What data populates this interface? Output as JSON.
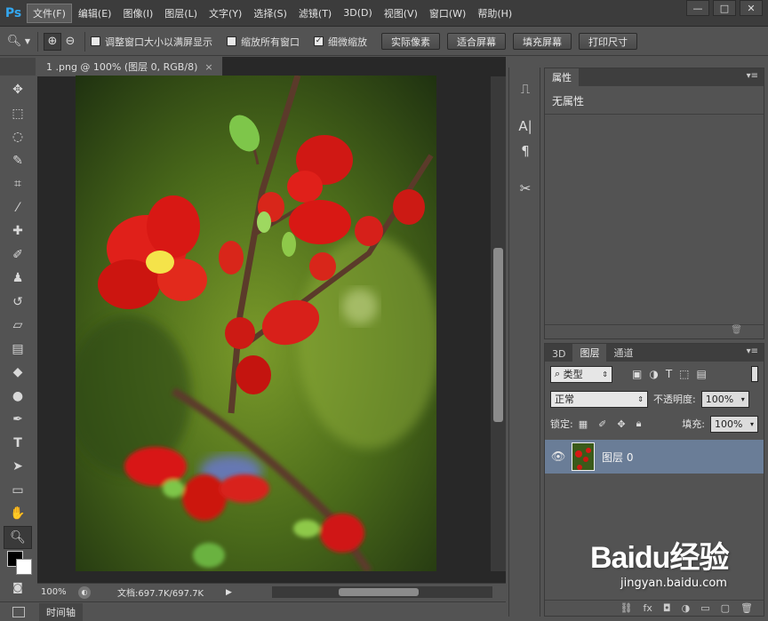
{
  "app": {
    "logo": "Ps"
  },
  "menu": [
    "文件(F)",
    "编辑(E)",
    "图像(I)",
    "图层(L)",
    "文字(Y)",
    "选择(S)",
    "滤镜(T)",
    "3D(D)",
    "视图(V)",
    "窗口(W)",
    "帮助(H)"
  ],
  "window_controls": [
    "—",
    "□",
    "✕"
  ],
  "options": {
    "check_resize": "调整窗口大小以满屏显示",
    "check_zoom_all": "缩放所有窗口",
    "check_scrubby": "细微缩放",
    "scrubby_checked": true,
    "btn_actual": "实际像素",
    "btn_fit": "适合屏幕",
    "btn_fill": "填充屏幕",
    "btn_print": "打印尺寸"
  },
  "document": {
    "tab_title": "1 .png @ 100% (图层 0, RGB/8)",
    "close": "×"
  },
  "status": {
    "zoom": "100%",
    "doc_info": "文档:697.7K/697.7K"
  },
  "timeline": {
    "label": "时间轴"
  },
  "properties": {
    "tab": "属性",
    "empty_text": "无属性"
  },
  "layers": {
    "tabs": [
      "3D",
      "图层",
      "通道"
    ],
    "filter_label": "类型",
    "blend_mode": "正常",
    "opacity_label": "不透明度:",
    "opacity_value": "100%",
    "lock_label": "锁定:",
    "fill_label": "填充:",
    "fill_value": "100%",
    "layer_name": "图层 0"
  },
  "watermark": {
    "brand": "Baidu经验",
    "url": "jingyan.baidu.com"
  },
  "colors": {
    "ps_blue": "#33a7f0",
    "layer_selected": "#6a7d97",
    "panel_bg": "#535353",
    "canvas_bg": "#282828"
  }
}
